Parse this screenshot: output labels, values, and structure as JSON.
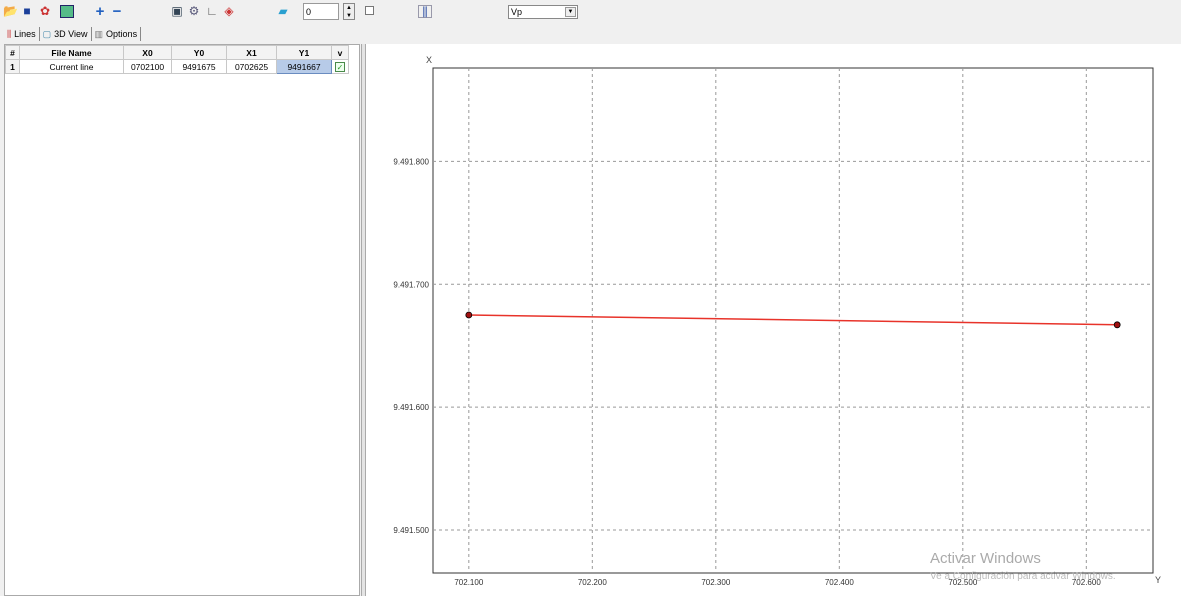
{
  "toolbar": {
    "spin_value": "0",
    "combo_value": "Vp"
  },
  "tabs": [
    {
      "label": "Lines"
    },
    {
      "label": "3D View"
    },
    {
      "label": "Options"
    }
  ],
  "table": {
    "headers": [
      "#",
      "File Name",
      "X0",
      "Y0",
      "X1",
      "Y1",
      "v"
    ],
    "rows": [
      {
        "n": "1",
        "name": "Current line",
        "x0": "0702100",
        "y0": "9491675",
        "x1": "0702625",
        "y1": "9491667",
        "visible": true
      }
    ]
  },
  "chart_data": {
    "type": "line",
    "xlabel": "Y",
    "ylabel": "X",
    "xlim": [
      702.071,
      702.654
    ],
    "ylim": [
      9491.465,
      9491.876
    ],
    "xticks": [
      702.1,
      702.2,
      702.3,
      702.4,
      702.5,
      702.6
    ],
    "xtick_labels": [
      "702.100",
      "702.200",
      "702.300",
      "702.400",
      "702.500",
      "702.600"
    ],
    "yticks": [
      9491.8,
      9491.7,
      9491.6,
      9491.5
    ],
    "ytick_labels": [
      "9.491.800",
      "9.491.700",
      "9.491.600",
      "9.491.500"
    ],
    "grid": true,
    "series": [
      {
        "name": "Current line",
        "color": "#e8332a",
        "points": [
          [
            702.1,
            9491.675
          ],
          [
            702.625,
            9491.667
          ]
        ]
      }
    ]
  },
  "watermark": {
    "title": "Activar Windows",
    "subtitle": "Ve a Configuración para activar Windows."
  }
}
